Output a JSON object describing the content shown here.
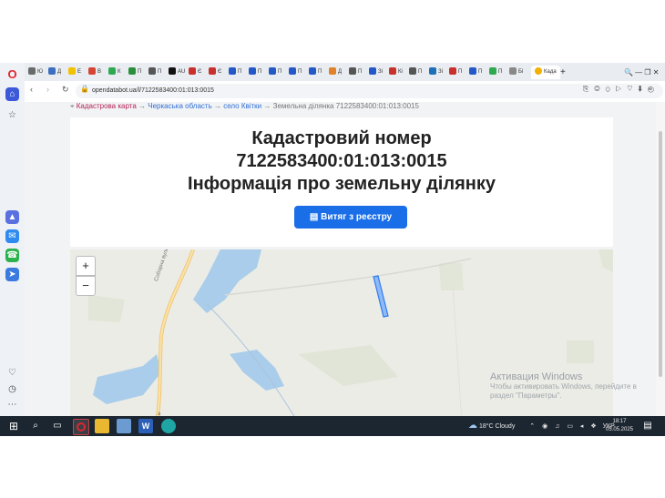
{
  "tabs": [
    {
      "label": "Ю",
      "color": "#6a6a6a"
    },
    {
      "label": "Д",
      "color": "#3b6fc0"
    },
    {
      "label": "Е",
      "color": "#f2c200"
    },
    {
      "label": "В",
      "color": "#d64533"
    },
    {
      "label": "К",
      "color": "#2da94f"
    },
    {
      "label": "П",
      "color": "#2a8f3b"
    },
    {
      "label": "П",
      "color": "#555555"
    },
    {
      "label": "AU",
      "color": "#111111"
    },
    {
      "label": "Є",
      "color": "#c8302c"
    },
    {
      "label": "Є",
      "color": "#c8302c"
    },
    {
      "label": "П",
      "color": "#2458c6"
    },
    {
      "label": "П",
      "color": "#2458c6"
    },
    {
      "label": "П",
      "color": "#2458c6"
    },
    {
      "label": "П",
      "color": "#2458c6"
    },
    {
      "label": "П",
      "color": "#2458c6"
    },
    {
      "label": "Д",
      "color": "#e0822a"
    },
    {
      "label": "П",
      "color": "#555555"
    },
    {
      "label": "Зі",
      "color": "#2458c6"
    },
    {
      "label": "Кі",
      "color": "#c8302c"
    },
    {
      "label": "П",
      "color": "#555555"
    },
    {
      "label": "Зі",
      "color": "#1d6fb8"
    },
    {
      "label": "П",
      "color": "#c8302c"
    },
    {
      "label": "П",
      "color": "#2458c6"
    },
    {
      "label": "П",
      "color": "#2da94f"
    },
    {
      "label": "Бі",
      "color": "#888888"
    }
  ],
  "active_tab": {
    "label": "Када",
    "color": "#f2b000"
  },
  "address": {
    "url": "opendatabot.ua/l/7122583400:01:013:0015"
  },
  "breadcrumbs": {
    "item1": "Кадастрова карта",
    "sep": "→",
    "item2": "Черкаська область",
    "item3": "село Квітки",
    "item4": "Земельна ділянка 7122583400:01:013:0015"
  },
  "card": {
    "line1": "Кадастровий номер",
    "line2": "7122583400:01:013:0015",
    "line3": "Інформація про земельну ділянку",
    "button_label": "Витяг з реєстру"
  },
  "map": {
    "zoom_in": "+",
    "zoom_out": "−",
    "road_label_1": "Соборна вулиця",
    "road_label_2": "а",
    "parcel_color": "#2f7cf0"
  },
  "watermark": {
    "title": "Активация Windows",
    "text": "Чтобы активировать Windows, перейдите в раздел \"Параметры\"."
  },
  "taskbar": {
    "weather": "18°C  Cloudy",
    "lang": "УКР",
    "time": "18:17",
    "date": "05.05.2025"
  }
}
